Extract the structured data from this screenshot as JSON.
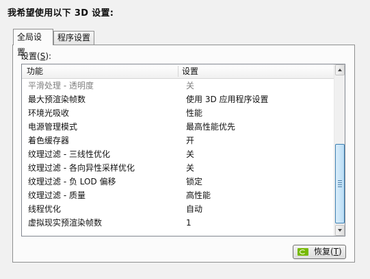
{
  "page": {
    "title": "我希望使用以下 3D 设置:"
  },
  "tabs": [
    {
      "label": "全局设置",
      "active": true
    },
    {
      "label": "程序设置",
      "active": false
    }
  ],
  "settings_group": {
    "label": "设置",
    "mnemonic": "S",
    "suffix": ":"
  },
  "table": {
    "columns": [
      "功能",
      "设置"
    ],
    "rows": [
      {
        "feature": "平滑处理 - 透明度",
        "setting": "关",
        "disabled": true
      },
      {
        "feature": "最大预渲染帧数",
        "setting": "使用 3D 应用程序设置",
        "disabled": false
      },
      {
        "feature": "环境光吸收",
        "setting": "性能",
        "disabled": false
      },
      {
        "feature": "电源管理模式",
        "setting": "最高性能优先",
        "disabled": false
      },
      {
        "feature": "着色缓存器",
        "setting": "开",
        "disabled": false
      },
      {
        "feature": "纹理过滤 - 三线性优化",
        "setting": "关",
        "disabled": false
      },
      {
        "feature": "纹理过滤 - 各向异性采样优化",
        "setting": "关",
        "disabled": false
      },
      {
        "feature": "纹理过滤 - 负 LOD 偏移",
        "setting": "锁定",
        "disabled": false
      },
      {
        "feature": "纹理过滤 - 质量",
        "setting": "高性能",
        "disabled": false
      },
      {
        "feature": "线程优化",
        "setting": "自动",
        "disabled": false
      },
      {
        "feature": "虚拟现实预渲染帧数",
        "setting": "1",
        "disabled": false
      }
    ]
  },
  "restore_button": {
    "label": "恢复",
    "mnemonic": "T",
    "icon": "nvidia-logo-icon"
  },
  "colors": {
    "nvidia_green": "#76b900",
    "scroll_thumb": "#b9dcf4"
  }
}
